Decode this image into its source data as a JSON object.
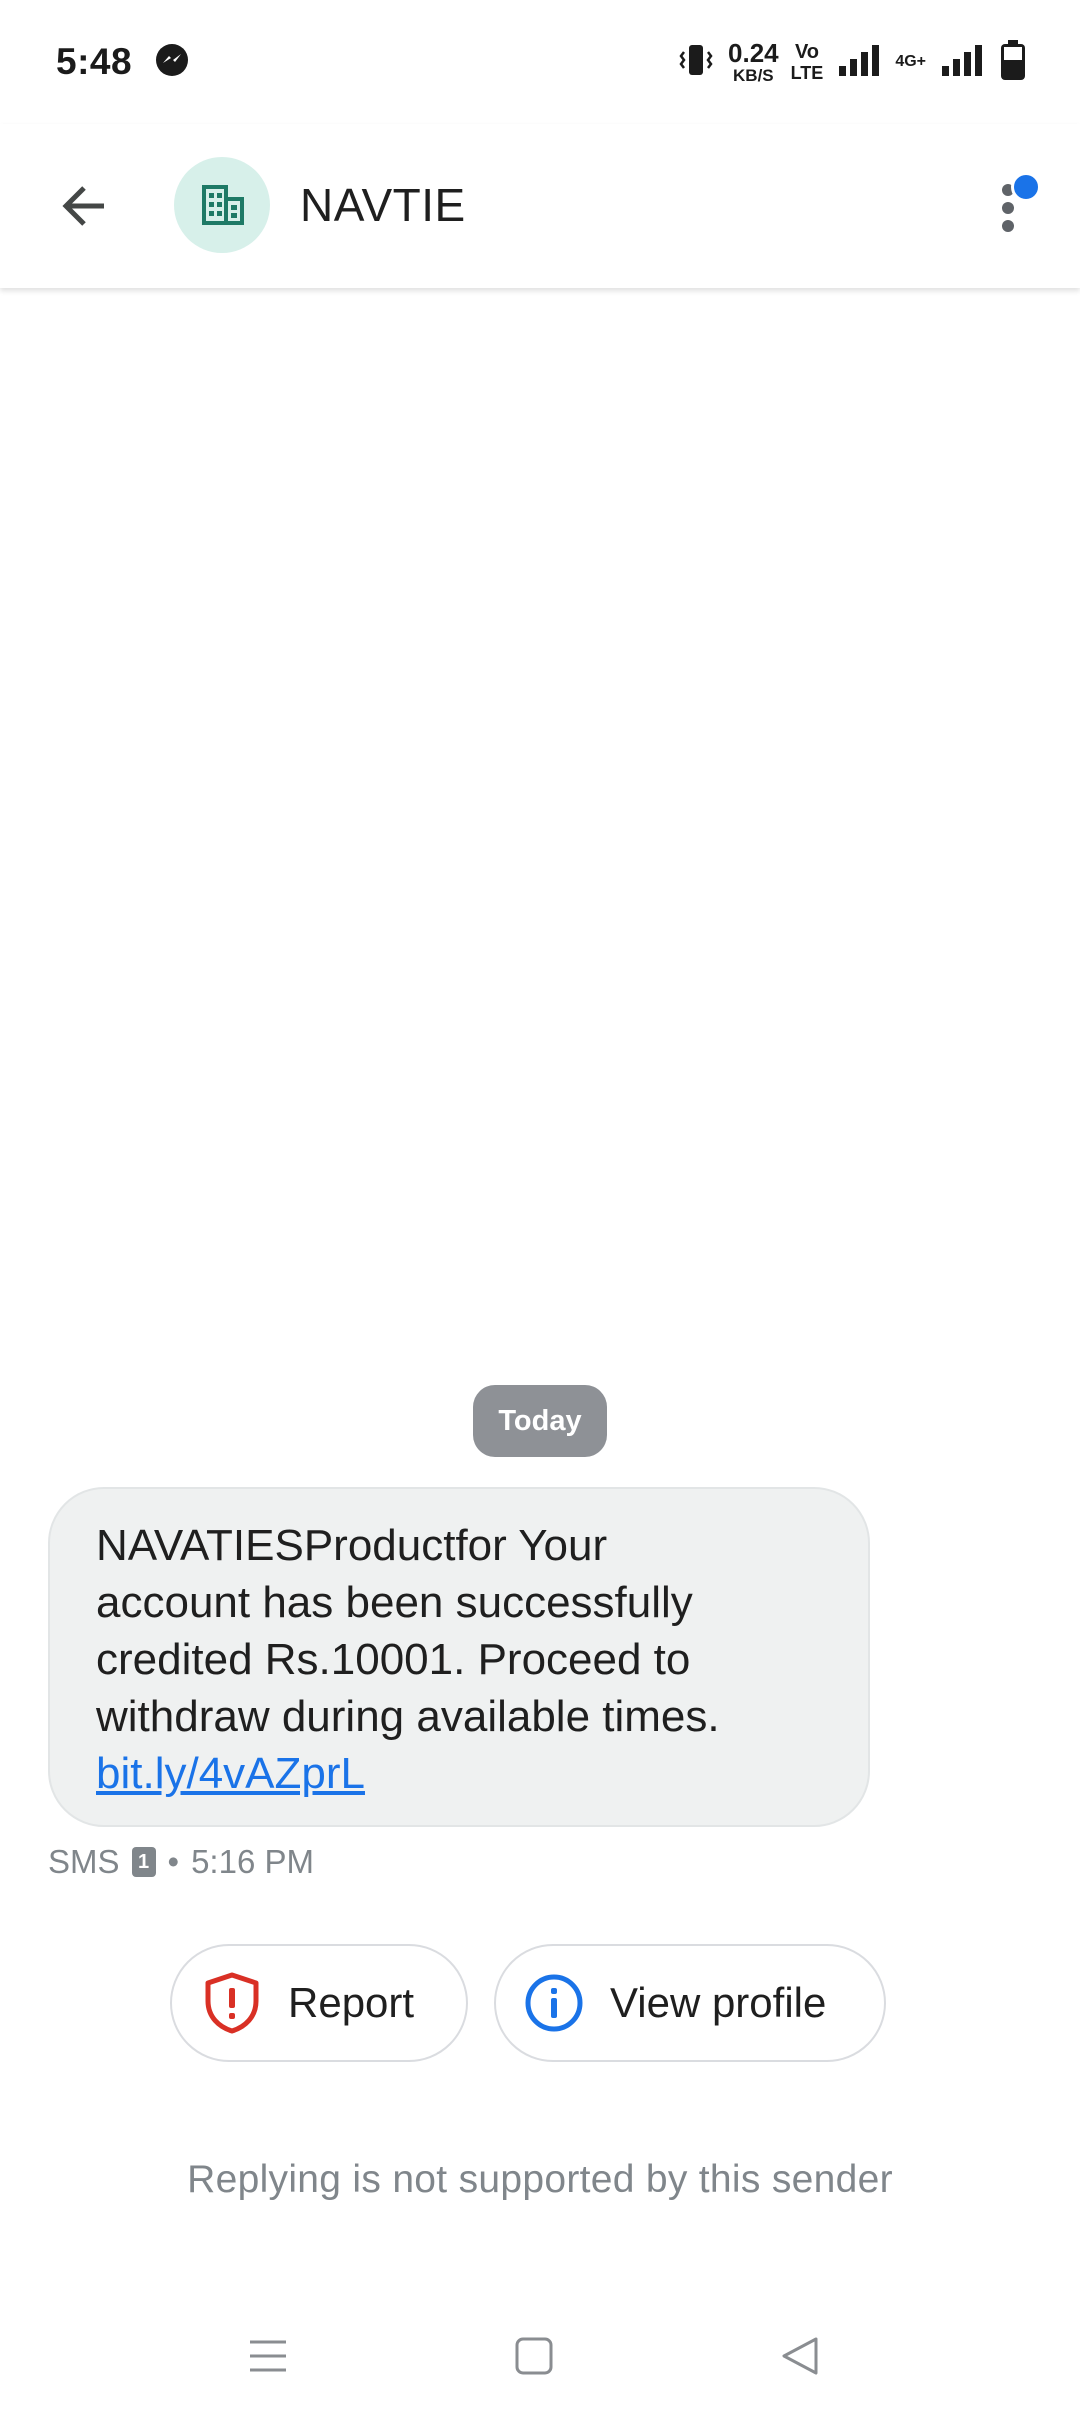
{
  "status_bar": {
    "time": "5:48",
    "net_speed_value": "0.24",
    "net_speed_unit": "KB/S",
    "volte_top": "Vo",
    "volte_bottom": "LTE",
    "network_type": "4G+",
    "icons": [
      "messenger-icon",
      "vibrate-icon",
      "signal-icon",
      "signal-4g-icon",
      "battery-icon"
    ]
  },
  "header": {
    "contact_name": "NAVTIE",
    "avatar_icon": "business-icon",
    "back_icon": "arrow-back-icon",
    "menu_icon": "more-vert-icon",
    "colors": {
      "avatar_bg": "#d7f0ea",
      "avatar_fg": "#1e7a66",
      "badge": "#1a73e8"
    }
  },
  "conversation": {
    "date_chip": "Today",
    "message": {
      "lines": [
        "NAVATIESProductfor Your",
        "account has been successfully",
        "credited Rs.10001. Proceed to",
        "withdraw during available times."
      ],
      "link": "bit.ly/4vAZprL",
      "type": "SMS",
      "sim": "1",
      "separator": "•",
      "time": "5:16 PM"
    }
  },
  "actions": {
    "report_label": "Report",
    "view_profile_label": "View profile",
    "colors": {
      "report": "#d93025",
      "info": "#1a73e8"
    }
  },
  "footer": {
    "reply_note": "Replying is not supported by this sender"
  },
  "nav_bar": {
    "icons": [
      "recents-icon",
      "home-icon",
      "back-triangle-icon"
    ]
  }
}
